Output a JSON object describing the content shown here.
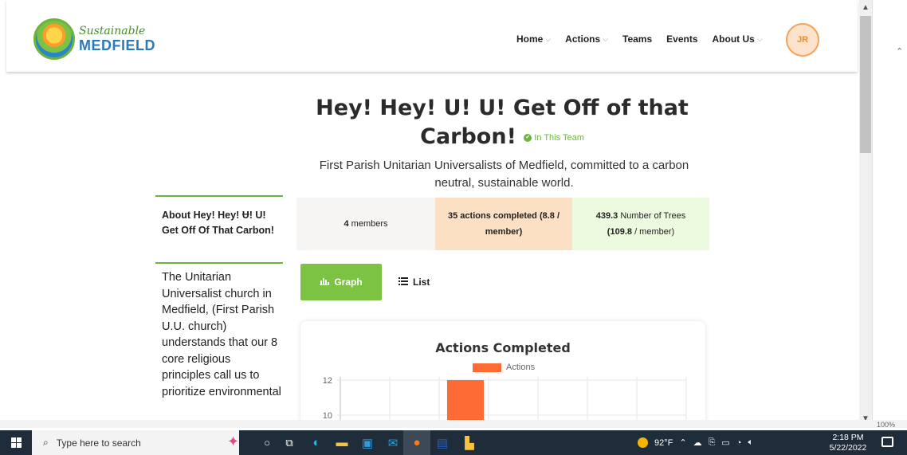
{
  "site": {
    "logo_top": "Sustainable",
    "logo_bottom": "MEDFIELD",
    "nav": [
      {
        "label": "Home",
        "has_dropdown": true
      },
      {
        "label": "Actions",
        "has_dropdown": true
      },
      {
        "label": "Teams",
        "has_dropdown": false
      },
      {
        "label": "Events",
        "has_dropdown": false
      },
      {
        "label": "About Us",
        "has_dropdown": true
      }
    ],
    "avatar_initials": "JR",
    "chevron": "⌵"
  },
  "team": {
    "title": "Hey! Hey! U! U! Get Off of that Carbon!",
    "status": "In This Team",
    "tagline": "First Parish Unitarian Universalists of Medfield, committed to a carbon neutral, sustainable world."
  },
  "stats": {
    "members_value": "4",
    "members_label": "members",
    "actions_value": "35",
    "actions_label": "actions completed",
    "actions_per_member": "(8.8 / member)",
    "trees_value": "439.3",
    "trees_label": "Number of Trees",
    "trees_per_member_value": "(109.8",
    "trees_per_member_label": "/ member)"
  },
  "sidebar": {
    "heading": "About Hey! Hey! Ʉ! U! Get Off Of That Carbon!",
    "body": "The Unitarian Universalist church in Medfield, (First Parish U.U. church) understands that our 8 core religious principles call us to prioritize environmental"
  },
  "toggle": {
    "graph_label": "Graph",
    "list_label": "List"
  },
  "chart_data": {
    "type": "bar",
    "title": "Actions Completed",
    "series": [
      {
        "name": "Actions",
        "color": "#ff6b35"
      }
    ],
    "y_ticks": [
      12,
      10
    ],
    "visible_bar": {
      "category_index": 2,
      "value": 12
    },
    "grid": true,
    "legend": "top-center"
  },
  "taskbar": {
    "search_placeholder": "Type here to search",
    "temperature": "92°F",
    "time": "2:18 PM",
    "date": "5/22/2022"
  },
  "word_status": {
    "zoom": "100%"
  }
}
